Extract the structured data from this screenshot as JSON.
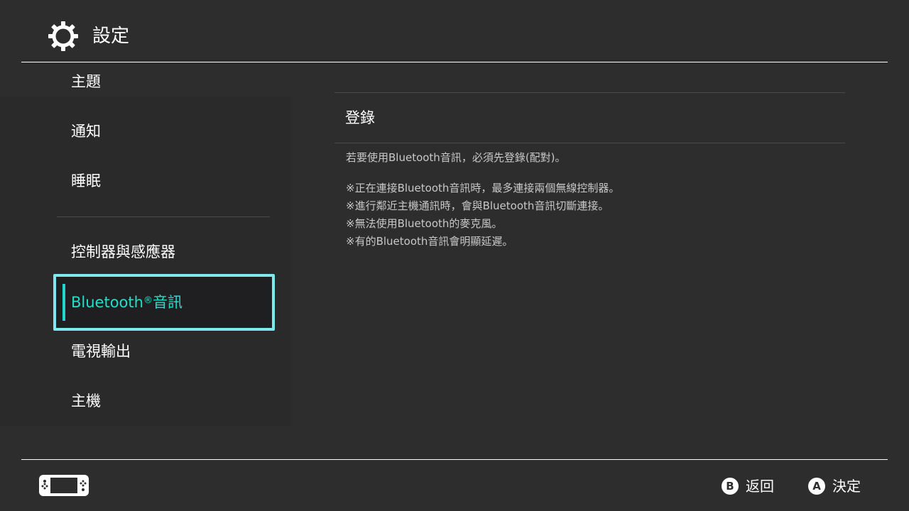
{
  "header": {
    "title": "設定",
    "icon": "gear-icon"
  },
  "sidebar": {
    "items": [
      {
        "label": "主題"
      },
      {
        "label": "通知"
      },
      {
        "label": "睡眠"
      },
      {
        "label": "控制器與感應器"
      },
      {
        "label": "Bluetooth",
        "label_suffix_mark": "®",
        "label_suffix": "音訊",
        "selected": true
      },
      {
        "label": "電視輸出"
      },
      {
        "label": "主機"
      }
    ]
  },
  "content": {
    "section_title": "登錄",
    "description": "若要使用Bluetooth音訊，必須先登錄(配對)。",
    "notes": [
      "※正在連接Bluetooth音訊時，最多連接兩個無線控制器。",
      "※進行鄰近主機通訊時，會與Bluetooth音訊切斷連接。",
      "※無法使用Bluetooth的麥克風。",
      "※有的Bluetooth音訊會明顯延遲。"
    ]
  },
  "footer": {
    "console_icon": "switch-console-icon",
    "back": {
      "key": "B",
      "label": "返回"
    },
    "confirm": {
      "key": "A",
      "label": "決定"
    }
  },
  "colors": {
    "background": "#2d2d2d",
    "sidebar": "#2a2a2a",
    "selection_border": "#7fe8ef",
    "selection_text": "#1fe0c8"
  }
}
